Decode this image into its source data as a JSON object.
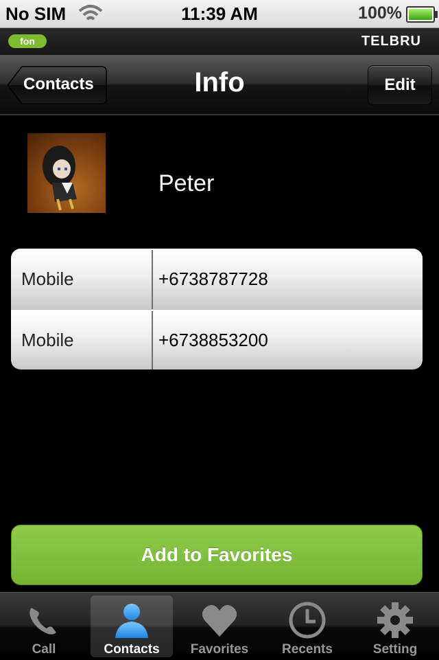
{
  "status_bar": {
    "carrier": "No SIM",
    "time": "11:39 AM",
    "battery_percent": "100%",
    "battery_level": 1.0,
    "battery_color": "#4cd137"
  },
  "brand_bar": {
    "logo_text": "fon",
    "operator": "TELBRU"
  },
  "nav_bar": {
    "back_label": "Contacts",
    "title": "Info",
    "edit_label": "Edit"
  },
  "contact": {
    "name": "Peter",
    "phones": [
      {
        "label": "Mobile",
        "value": "+6738787728"
      },
      {
        "label": "Mobile",
        "value": "+6738853200"
      }
    ]
  },
  "actions": {
    "add_favorites_label": "Add to Favorites",
    "accent_color": "#7fbf3d"
  },
  "tab_bar": {
    "active": "Contacts",
    "active_color": "#3aa0f0",
    "tabs": [
      {
        "label": "Call",
        "icon": "phone-icon"
      },
      {
        "label": "Contacts",
        "icon": "person-icon"
      },
      {
        "label": "Favorites",
        "icon": "heart-icon"
      },
      {
        "label": "Recents",
        "icon": "clock-icon"
      },
      {
        "label": "Setting",
        "icon": "gear-icon"
      }
    ]
  }
}
